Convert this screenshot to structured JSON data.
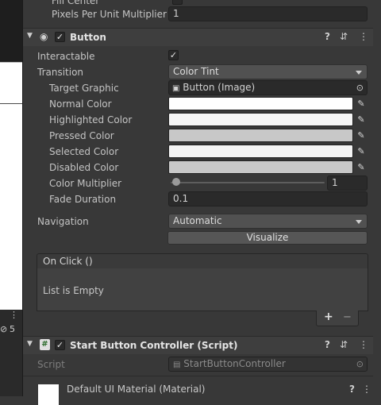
{
  "image_field": {
    "fill_center_label": "Fill Center",
    "ppu_label": "Pixels Per Unit Multiplier",
    "ppu_value": "1"
  },
  "button_component": {
    "title": "Button",
    "enabled_check": "✓",
    "interactable_label": "Interactable",
    "interactable_check": "✓",
    "transition_label": "Transition",
    "transition_value": "Color Tint",
    "target_graphic_label": "Target Graphic",
    "target_graphic_value": "Button (Image)",
    "colors": [
      {
        "label": "Normal Color",
        "color": "#ffffff"
      },
      {
        "label": "Highlighted Color",
        "color": "#f5f5f5"
      },
      {
        "label": "Pressed Color",
        "color": "#c8c8c8"
      },
      {
        "label": "Selected Color",
        "color": "#f5f5f5"
      },
      {
        "label": "Disabled Color",
        "color": "#c8c8c8"
      }
    ],
    "color_multiplier_label": "Color Multiplier",
    "color_multiplier_value": "1",
    "color_multiplier_fraction": 0.2,
    "fade_duration_label": "Fade Duration",
    "fade_duration_value": "0.1",
    "navigation_label": "Navigation",
    "navigation_value": "Automatic",
    "visualize_label": "Visualize",
    "onclick_title": "On Click ()",
    "onclick_empty": "List is Empty",
    "add_label": "+",
    "remove_label": "−"
  },
  "script_component": {
    "title": "Start Button Controller (Script)",
    "hash": "#",
    "enabled_check": "✓",
    "script_label": "Script",
    "script_value": "StartButtonController"
  },
  "material": {
    "title": "Default UI Material (Material)"
  },
  "left_panel": {
    "badge_count": "5"
  },
  "icons": {
    "help": "?",
    "settings": "⇵",
    "more": "⋮",
    "foldout": "▼",
    "picker": "⊙",
    "eyedropper": "✎"
  }
}
